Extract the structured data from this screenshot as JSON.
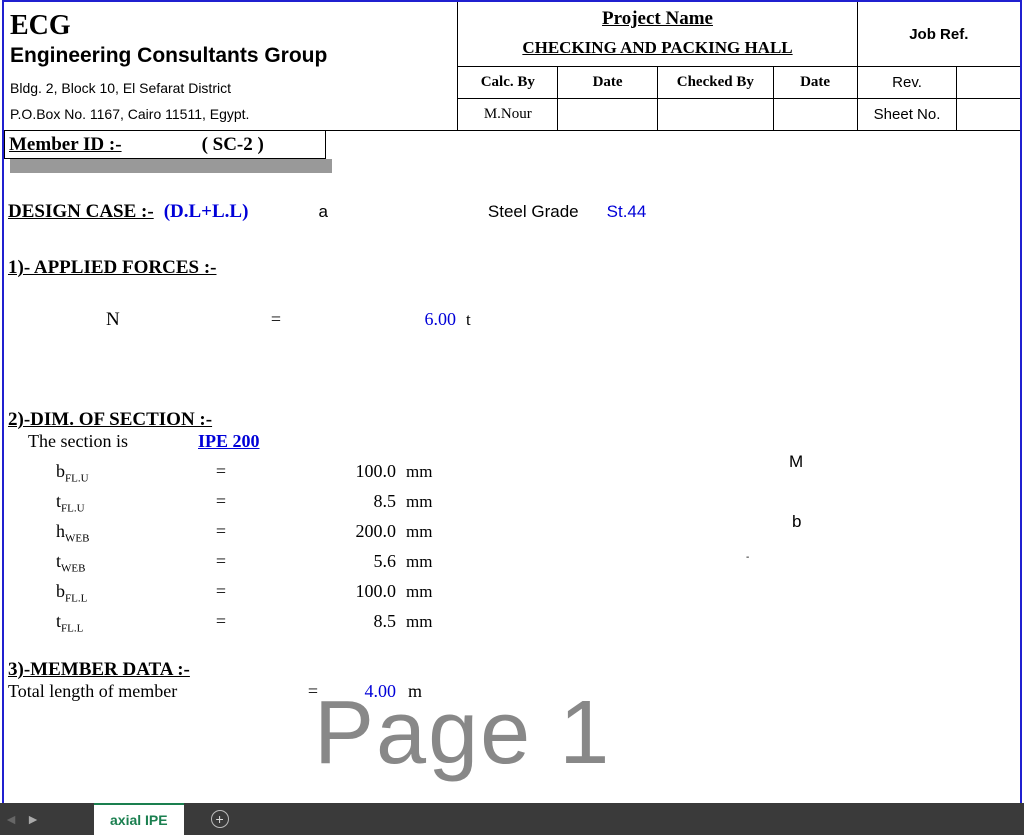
{
  "company": {
    "short": "ECG",
    "name": "Engineering Consultants Group",
    "address1": "Bldg. 2, Block 10, El Sefarat District",
    "address2": "P.O.Box No. 1167, Cairo 11511, Egypt."
  },
  "header": {
    "project_name_label": "Project Name",
    "project_name": "CHECKING AND PACKING HALL",
    "job_ref_label": "Job Ref.",
    "calc_by_label": "Calc. By",
    "date_label": "Date",
    "checked_by_label": "Checked By",
    "date2_label": "Date",
    "rev_label": "Rev.",
    "sheet_no_label": "Sheet No.",
    "calc_by": "M.Nour",
    "date": "",
    "checked_by": "",
    "date2": "",
    "rev": "",
    "sheet_no": ""
  },
  "member": {
    "label": "Member ID :-",
    "value": "( SC-2 )"
  },
  "design_case": {
    "label": "DESIGN CASE :- ",
    "value": "(D.L+L.L)",
    "letter": "a",
    "steel_grade_label": "Steel Grade",
    "steel_grade": "St.44"
  },
  "applied_forces": {
    "title": "1)- APPLIED FORCES :-",
    "rows": [
      {
        "sym": "N",
        "sub": "",
        "eq": "=",
        "val": "6.00",
        "unit": "t"
      }
    ]
  },
  "dim_section": {
    "title": "2)-DIM. OF SECTION :-",
    "section_is_label": "The section is",
    "section_name": "IPE 200",
    "rows": [
      {
        "sym": "b",
        "sub": "FL.U",
        "eq": "=",
        "val": "100.0",
        "unit": "mm"
      },
      {
        "sym": "t",
        "sub": "FL.U",
        "eq": "=",
        "val": "8.5",
        "unit": "mm"
      },
      {
        "sym": "h",
        "sub": "WEB",
        "eq": "=",
        "val": "200.0",
        "unit": "mm"
      },
      {
        "sym": "t",
        "sub": "WEB",
        "eq": "=",
        "val": "5.6",
        "unit": "mm"
      },
      {
        "sym": "b",
        "sub": "FL.L",
        "eq": "=",
        "val": "100.0",
        "unit": "mm"
      },
      {
        "sym": "t",
        "sub": "FL.L",
        "eq": "=",
        "val": "8.5",
        "unit": "mm"
      }
    ],
    "diagram": {
      "M": "M",
      "b": "b",
      "dash": "-"
    }
  },
  "member_data": {
    "title": "3)-MEMBER DATA :-",
    "rows": [
      {
        "label": "Total length of member",
        "eq": "=",
        "val": "4.00",
        "unit": "m"
      }
    ]
  },
  "watermark": "Page 1",
  "tabs": {
    "active": "axial IPE"
  }
}
